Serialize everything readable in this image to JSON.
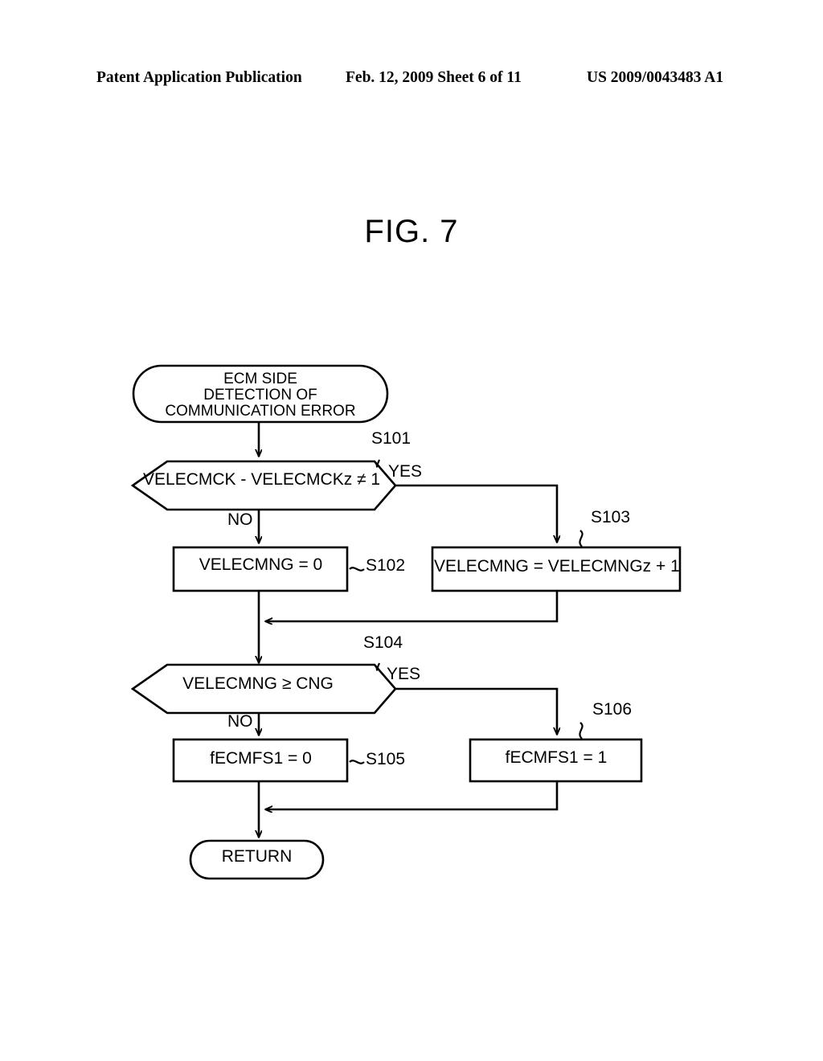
{
  "header": {
    "left": "Patent Application Publication",
    "middle": "Feb. 12, 2009  Sheet 6 of 11",
    "right": "US 2009/0043483 A1"
  },
  "figure": {
    "title": "FIG. 7"
  },
  "flowchart": {
    "start": {
      "step": "",
      "text": "ECM SIDE\nDETECTION OF\nCOMMUNICATION ERROR"
    },
    "decision_s101": {
      "step": "S101",
      "text": "VELECMCK - VELECMCKz ≠ 1",
      "yes_label": "YES",
      "no_label": "NO"
    },
    "process_s102": {
      "step": "S102",
      "text": "VELECMNG = 0"
    },
    "process_s103": {
      "step": "S103",
      "text": "VELECMNG = VELECMNGz + 1"
    },
    "decision_s104": {
      "step": "S104",
      "text": "VELECMNG ≥ CNG",
      "yes_label": "YES",
      "no_label": "NO"
    },
    "process_s105": {
      "step": "S105",
      "text": "fECMFS1 = 0"
    },
    "process_s106": {
      "step": "S106",
      "text": "fECMFS1 = 1"
    },
    "end": {
      "text": "RETURN"
    }
  },
  "colors": {
    "ink": "#000000",
    "paper": "#ffffff"
  }
}
